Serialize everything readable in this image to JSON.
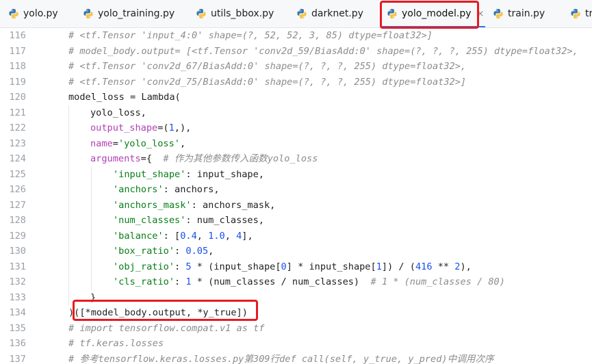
{
  "tabs": [
    {
      "label": "yolo.py",
      "active": false
    },
    {
      "label": "yolo_training.py",
      "active": false
    },
    {
      "label": "utils_bbox.py",
      "active": false
    },
    {
      "label": "darknet.py",
      "active": false
    },
    {
      "label": "yolo_model.py",
      "active": true
    },
    {
      "label": "train.py",
      "active": false
    },
    {
      "label": "tr",
      "active": false
    }
  ],
  "close_glyph": "×",
  "colors": {
    "accent": "#3574f0",
    "annotation": "#e8191f",
    "python_blue": "#3b77a8",
    "python_yellow": "#f5c542"
  },
  "icon_names": [
    "python-file-icon",
    "close-icon"
  ],
  "editor": {
    "lines": [
      {
        "n": "116",
        "indent": 0,
        "tokens": [
          [
            "c",
            "# <tf.Tensor 'input_4:0' shape=(?, 52, 52, 3, 85) dtype=float32>]"
          ]
        ]
      },
      {
        "n": "117",
        "indent": 0,
        "tokens": [
          [
            "c",
            "# model_body.output= [<tf.Tensor 'conv2d_59/BiasAdd:0' shape=(?, ?, ?, 255) dtype=float32>,"
          ]
        ]
      },
      {
        "n": "118",
        "indent": 0,
        "tokens": [
          [
            "c",
            "# <tf.Tensor 'conv2d_67/BiasAdd:0' shape=(?, ?, ?, 255) dtype=float32>,"
          ]
        ]
      },
      {
        "n": "119",
        "indent": 0,
        "tokens": [
          [
            "c",
            "# <tf.Tensor 'conv2d_75/BiasAdd:0' shape=(?, ?, ?, 255) dtype=float32>]"
          ]
        ]
      },
      {
        "n": "120",
        "indent": 0,
        "tokens": [
          [
            "p",
            "model_loss = Lambda("
          ]
        ]
      },
      {
        "n": "121",
        "indent": 1,
        "tokens": [
          [
            "p",
            "yolo_loss,"
          ]
        ]
      },
      {
        "n": "122",
        "indent": 1,
        "tokens": [
          [
            "k",
            "output_shape"
          ],
          [
            "p",
            "=("
          ],
          [
            "n",
            "1"
          ],
          [
            "p",
            ",),"
          ]
        ]
      },
      {
        "n": "123",
        "indent": 1,
        "tokens": [
          [
            "k",
            "name"
          ],
          [
            "p",
            "="
          ],
          [
            "s",
            "'yolo_loss'"
          ],
          [
            "p",
            ","
          ]
        ]
      },
      {
        "n": "124",
        "indent": 1,
        "tokens": [
          [
            "k",
            "arguments"
          ],
          [
            "p",
            "={  "
          ],
          [
            "c",
            "# 作为其他参数传入函数yolo_loss"
          ]
        ]
      },
      {
        "n": "125",
        "indent": 2,
        "tokens": [
          [
            "s",
            "'input_shape'"
          ],
          [
            "p",
            ": input_shape,"
          ]
        ]
      },
      {
        "n": "126",
        "indent": 2,
        "tokens": [
          [
            "s",
            "'anchors'"
          ],
          [
            "p",
            ": anchors,"
          ]
        ]
      },
      {
        "n": "127",
        "indent": 2,
        "tokens": [
          [
            "s",
            "'anchors_mask'"
          ],
          [
            "p",
            ": anchors_mask,"
          ]
        ]
      },
      {
        "n": "128",
        "indent": 2,
        "tokens": [
          [
            "s",
            "'num_classes'"
          ],
          [
            "p",
            ": num_classes,"
          ]
        ]
      },
      {
        "n": "129",
        "indent": 2,
        "tokens": [
          [
            "s",
            "'balance'"
          ],
          [
            "p",
            ": ["
          ],
          [
            "n",
            "0.4"
          ],
          [
            "p",
            ", "
          ],
          [
            "n",
            "1.0"
          ],
          [
            "p",
            ", "
          ],
          [
            "n",
            "4"
          ],
          [
            "p",
            "],"
          ]
        ]
      },
      {
        "n": "130",
        "indent": 2,
        "tokens": [
          [
            "s",
            "'box_ratio'"
          ],
          [
            "p",
            ": "
          ],
          [
            "n",
            "0.05"
          ],
          [
            "p",
            ","
          ]
        ]
      },
      {
        "n": "131",
        "indent": 2,
        "tokens": [
          [
            "s",
            "'obj_ratio'"
          ],
          [
            "p",
            ": "
          ],
          [
            "n",
            "5"
          ],
          [
            "p",
            " * (input_shape["
          ],
          [
            "n",
            "0"
          ],
          [
            "p",
            "] * input_shape["
          ],
          [
            "n",
            "1"
          ],
          [
            "p",
            "]) / ("
          ],
          [
            "n",
            "416"
          ],
          [
            "p",
            " ** "
          ],
          [
            "n",
            "2"
          ],
          [
            "p",
            "),"
          ]
        ]
      },
      {
        "n": "132",
        "indent": 2,
        "tokens": [
          [
            "s",
            "'cls_ratio'"
          ],
          [
            "p",
            ": "
          ],
          [
            "n",
            "1"
          ],
          [
            "p",
            " * (num_classes / num_classes)  "
          ],
          [
            "c",
            "# 1 * (num_classes / 80)"
          ]
        ]
      },
      {
        "n": "133",
        "indent": 1,
        "tokens": [
          [
            "p",
            "}"
          ]
        ]
      },
      {
        "n": "134",
        "indent": 0,
        "tokens": [
          [
            "p",
            ")([*model_body.output, *y_true])"
          ]
        ]
      },
      {
        "n": "135",
        "indent": 0,
        "tokens": [
          [
            "c",
            "# import tensorflow.compat.v1 as tf"
          ]
        ]
      },
      {
        "n": "136",
        "indent": 0,
        "tokens": [
          [
            "c",
            "# tf.keras.losses"
          ]
        ]
      },
      {
        "n": "137",
        "indent": 0,
        "tokens": [
          [
            "c",
            "# 参考tensorflow.keras.losses.py第309行def call(self, y_true, y_pred)中调用次序"
          ]
        ]
      }
    ]
  }
}
